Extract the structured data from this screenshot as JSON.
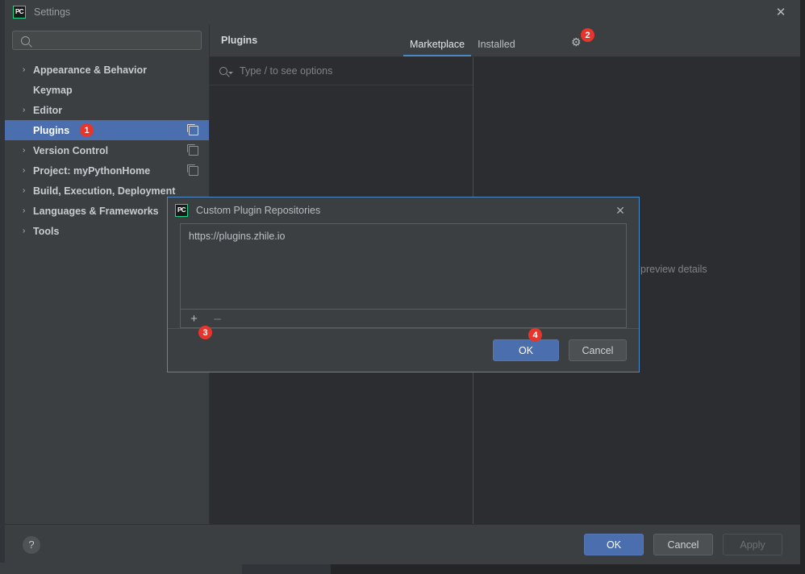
{
  "window": {
    "title": "Settings",
    "app_icon": "pycharm-icon",
    "close_icon": "close-icon"
  },
  "sidebar": {
    "search": {
      "value": "",
      "placeholder": "",
      "icon": "search-icon"
    },
    "items": [
      {
        "label": "Appearance & Behavior",
        "expandable": true,
        "selected": false,
        "has_copy_icon": false
      },
      {
        "label": "Keymap",
        "expandable": false,
        "selected": false,
        "has_copy_icon": false
      },
      {
        "label": "Editor",
        "expandable": true,
        "selected": false,
        "has_copy_icon": false
      },
      {
        "label": "Plugins",
        "expandable": false,
        "selected": true,
        "has_copy_icon": true
      },
      {
        "label": "Version Control",
        "expandable": true,
        "selected": false,
        "has_copy_icon": true
      },
      {
        "label": "Project: myPythonHome",
        "expandable": true,
        "selected": false,
        "has_copy_icon": true
      },
      {
        "label": "Build, Execution, Deployment",
        "expandable": true,
        "selected": false,
        "has_copy_icon": false
      },
      {
        "label": "Languages & Frameworks",
        "expandable": true,
        "selected": false,
        "has_copy_icon": false
      },
      {
        "label": "Tools",
        "expandable": true,
        "selected": false,
        "has_copy_icon": false
      }
    ]
  },
  "plugins_page": {
    "title": "Plugins",
    "tabs": [
      {
        "label": "Marketplace",
        "active": true
      },
      {
        "label": "Installed",
        "active": false
      }
    ],
    "settings_icon": "gear-icon",
    "search": {
      "placeholder": "Type / to see options",
      "icon": "search-icon"
    },
    "detail_placeholder": "preview details"
  },
  "dialog": {
    "title": "Custom Plugin Repositories",
    "app_icon": "pycharm-icon",
    "close_icon": "close-icon",
    "repositories": [
      "https://plugins.zhile.io"
    ],
    "toolbar": {
      "add_label": "+",
      "remove_label": "–"
    },
    "ok_label": "OK",
    "cancel_label": "Cancel"
  },
  "footer": {
    "help_label": "?",
    "ok_label": "OK",
    "cancel_label": "Cancel",
    "apply_label": "Apply"
  },
  "annotations": [
    {
      "number": "1",
      "target": "sidebar-plugins"
    },
    {
      "number": "2",
      "target": "plugins-gear"
    },
    {
      "number": "3",
      "target": "dialog-add-button"
    },
    {
      "number": "4",
      "target": "dialog-ok-button"
    }
  ],
  "colors": {
    "accent_blue": "#4b6eaf",
    "tab_underline": "#4a88c7",
    "badge_red": "#e8352c",
    "dialog_border": "#4a88c7",
    "window_bg": "#3c3f41",
    "list_bg": "#2b2d30"
  }
}
